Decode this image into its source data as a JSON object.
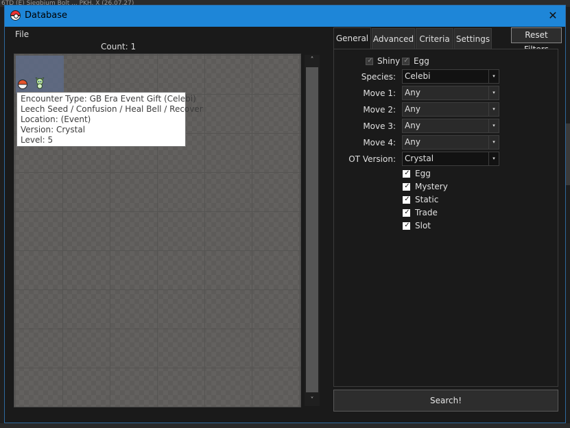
{
  "background": {
    "text": "6TD (E)    Siegbium Bolt ...    PKH. X (26.07.27)"
  },
  "window": {
    "title": "Database",
    "close_glyph": "✕"
  },
  "menu": {
    "file": "File"
  },
  "results": {
    "count_label": "Count: 1",
    "tooltip": [
      "Encounter Type: GB Era Event Gift (Celebi)",
      "Leech Seed / Confusion / Heal Bell / Recover",
      "Location: (Event)",
      "Version: Crystal",
      "Level: 5"
    ]
  },
  "scroll": {
    "up": "˄",
    "down": "˅"
  },
  "tabs": [
    "General",
    "Advanced",
    "Criteria",
    "Settings"
  ],
  "reset_filters": "Reset Filters",
  "general": {
    "shiny": "Shiny",
    "egg_top": "Egg",
    "species_label": "Species:",
    "species_value": "Celebi",
    "move1_label": "Move 1:",
    "move1_value": "Any",
    "move2_label": "Move 2:",
    "move2_value": "Any",
    "move3_label": "Move 3:",
    "move3_value": "Any",
    "move4_label": "Move 4:",
    "move4_value": "Any",
    "ot_label": "OT Version:",
    "ot_value": "Crystal",
    "checks": [
      "Egg",
      "Mystery",
      "Static",
      "Trade",
      "Slot"
    ]
  },
  "search_button": "Search!",
  "icons": {
    "app": "pokeball-icon",
    "slot_item": "pokeball-icon",
    "sprite": "celebi-sprite-icon",
    "dropdown": "▾",
    "check": "✓"
  },
  "colors": {
    "titlebar": "#1e86d8",
    "grid": "#757371",
    "panel": "#1a1a1a"
  }
}
